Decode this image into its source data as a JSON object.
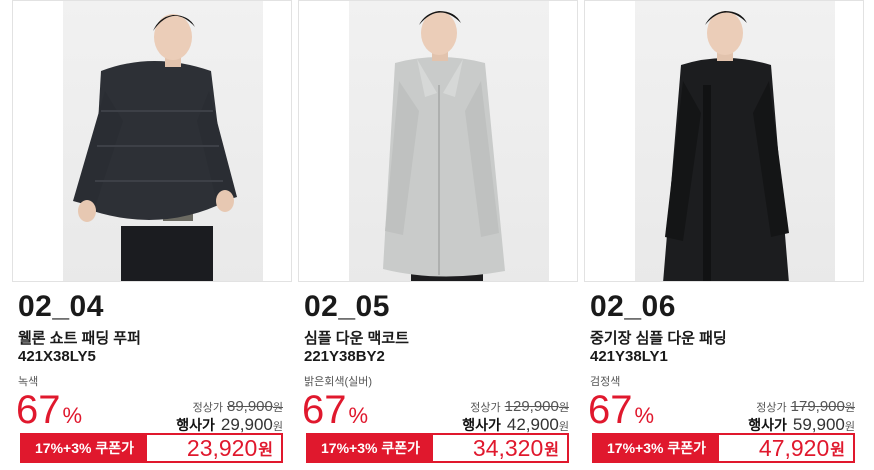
{
  "products": [
    {
      "code": "02_04",
      "name": "웰론 쇼트 패딩 푸퍼",
      "sku": "421X38LY5",
      "color": "녹색",
      "discount_percent": "67",
      "percent_sign": "%",
      "regular_label": "정상가",
      "regular_price": "89,900",
      "event_label": "행사가",
      "event_price": "29,900",
      "currency": "원",
      "coupon_label": "17%+3% 쿠폰가",
      "coupon_price": "23,920",
      "image_alt": "short-padding-jacket-model-photo",
      "jacket_color": "#2d3036"
    },
    {
      "code": "02_05",
      "name": "심플 다운 맥코트",
      "sku": "221Y38BY2",
      "color": "밝은회색(실버)",
      "discount_percent": "67",
      "percent_sign": "%",
      "regular_label": "정상가",
      "regular_price": "129,900",
      "event_label": "행사가",
      "event_price": "42,900",
      "currency": "원",
      "coupon_label": "17%+3% 쿠폰가",
      "coupon_price": "34,320",
      "image_alt": "silver-down-mac-coat-model-photo",
      "jacket_color": "#c9cbca"
    },
    {
      "code": "02_06",
      "name": "중기장 심플 다운 패딩",
      "sku": "421Y38LY1",
      "color": "검정색",
      "discount_percent": "67",
      "percent_sign": "%",
      "regular_label": "정상가",
      "regular_price": "179,900",
      "event_label": "행사가",
      "event_price": "59,900",
      "currency": "원",
      "coupon_label": "17%+3% 쿠폰가",
      "coupon_price": "47,920",
      "image_alt": "black-mid-length-down-padding-model-photo",
      "jacket_color": "#1c1d1f"
    }
  ],
  "colors": {
    "accent_red": "#e0182d",
    "text_dark": "#1a1a1a",
    "text_muted": "#555555",
    "border_light": "#e2e2e2"
  }
}
